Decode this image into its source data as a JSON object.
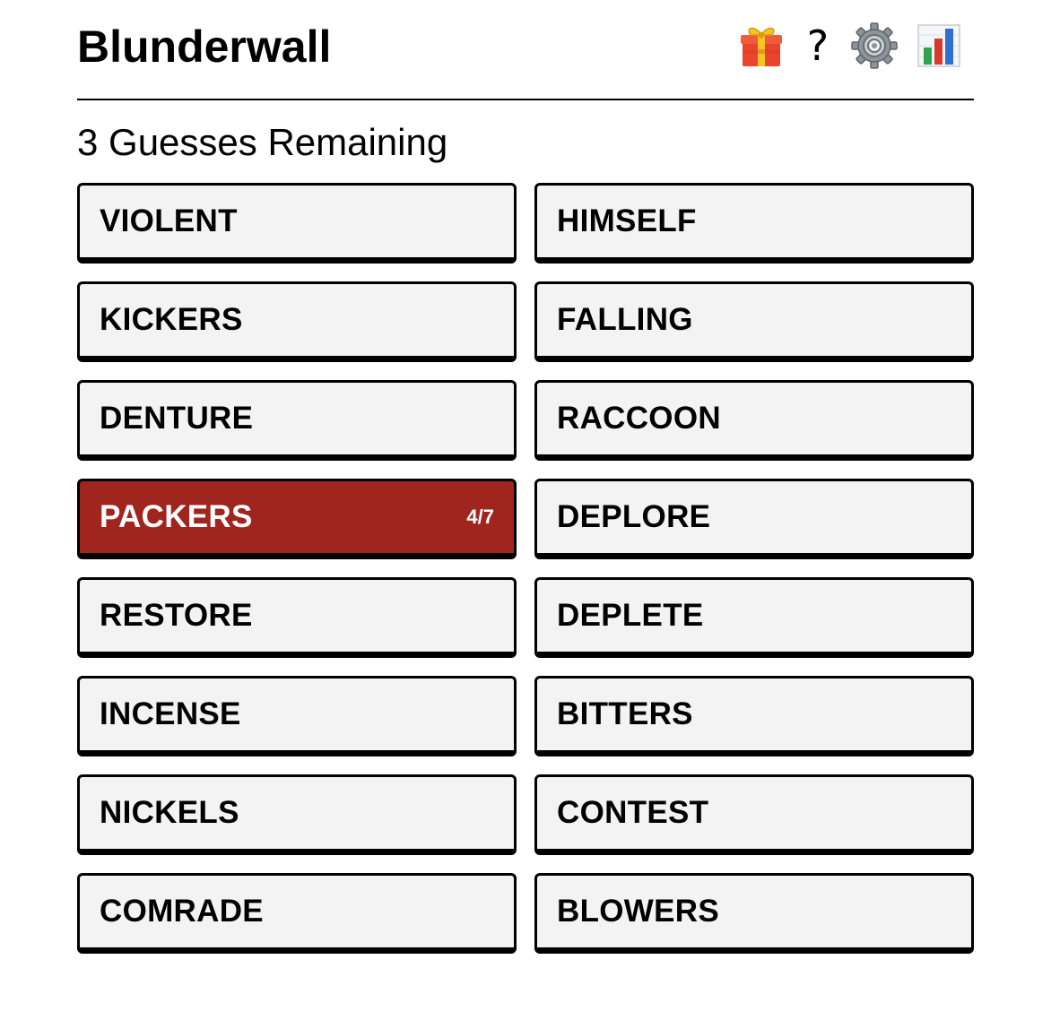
{
  "header": {
    "title": "Blunderwall",
    "icons": [
      "gift-icon",
      "help-icon",
      "gear-icon",
      "stats-chart-icon"
    ],
    "help_glyph": "?"
  },
  "status": {
    "guesses_remaining": "3 Guesses Remaining"
  },
  "tiles": [
    {
      "word": "VIOLENT"
    },
    {
      "word": "HIMSELF"
    },
    {
      "word": "KICKERS"
    },
    {
      "word": "FALLING"
    },
    {
      "word": "DENTURE"
    },
    {
      "word": "RACCOON"
    },
    {
      "word": "PACKERS",
      "selected": true,
      "count": "4/7"
    },
    {
      "word": "DEPLORE"
    },
    {
      "word": "RESTORE"
    },
    {
      "word": "DEPLETE"
    },
    {
      "word": "INCENSE"
    },
    {
      "word": "BITTERS"
    },
    {
      "word": "NICKELS"
    },
    {
      "word": "CONTEST"
    },
    {
      "word": "COMRADE"
    },
    {
      "word": "BLOWERS"
    }
  ],
  "colors": {
    "selected_tile": "#a0251f",
    "tile_background": "#f3f3f3",
    "tile_border": "#000000"
  }
}
